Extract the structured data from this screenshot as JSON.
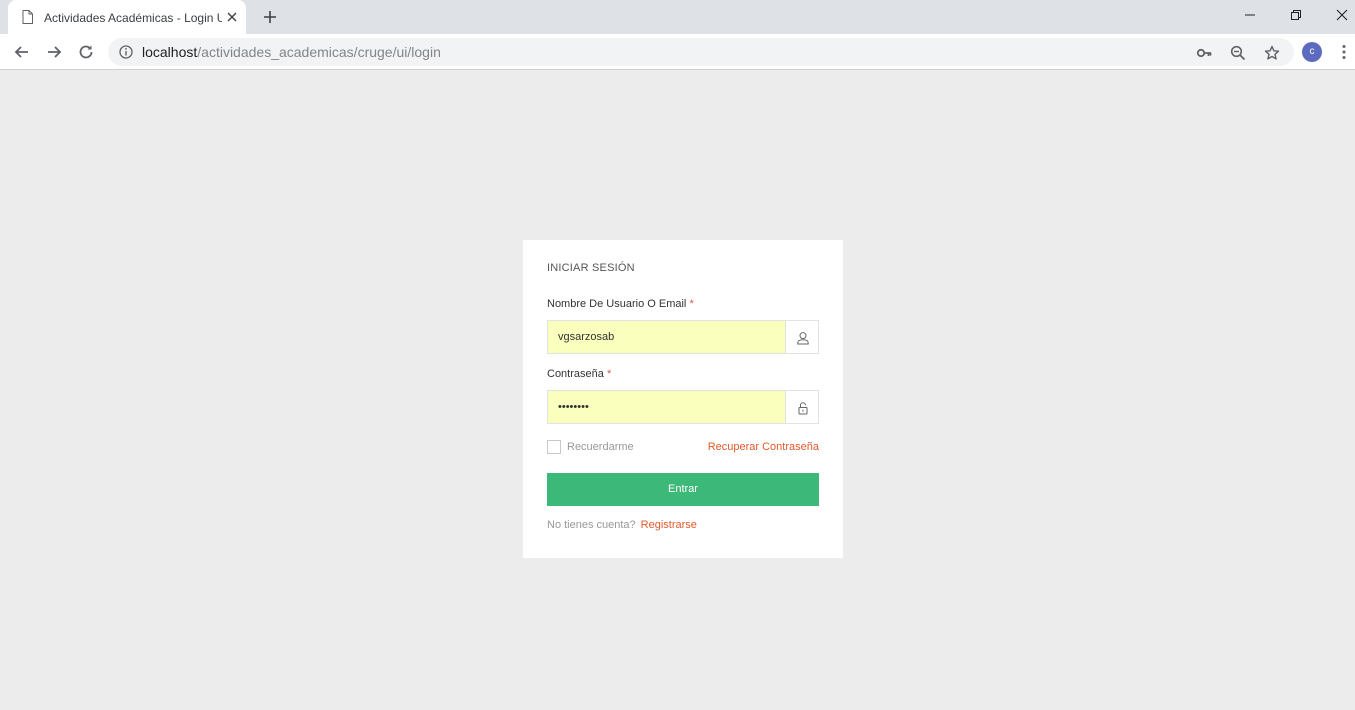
{
  "browser": {
    "tab_title": "Actividades Académicas - Login Usuario",
    "url_host": "localhost",
    "url_path": "/actividades_academicas/cruge/ui/login",
    "profile_initial": "c",
    "icons": {
      "tab_favicon": "page-icon",
      "tab_close": "close-icon",
      "new_tab": "plus-icon",
      "back": "arrow-left-icon",
      "forward": "arrow-right-icon",
      "reload": "reload-icon",
      "site_info": "info-icon",
      "passwords": "key-icon",
      "zoom": "zoom-out-icon",
      "bookmark": "star-icon",
      "menu": "more-vert-icon",
      "minimize": "minimize-icon",
      "restore": "restore-icon",
      "close": "close-icon"
    }
  },
  "login": {
    "title": "INICIAR SESIÓN",
    "username_label": "Nombre De Usuario O Email",
    "username_value": "vgsarzosab",
    "password_label": "Contraseña",
    "password_value": "••••••••",
    "required_mark": "*",
    "remember_label": "Recuerdarme",
    "remember_checked": false,
    "recover_link": "Recuperar Contraseña",
    "submit_label": "Entrar",
    "signup_text": "No tienes cuenta?",
    "signup_link": "Registrarse",
    "icons": {
      "username_addon": "user-icon",
      "password_addon": "lock-icon"
    },
    "colors": {
      "submit": "#3cb878",
      "link": "#e05a2b",
      "required": "#d9534f",
      "autofill": "#faffbd"
    }
  }
}
